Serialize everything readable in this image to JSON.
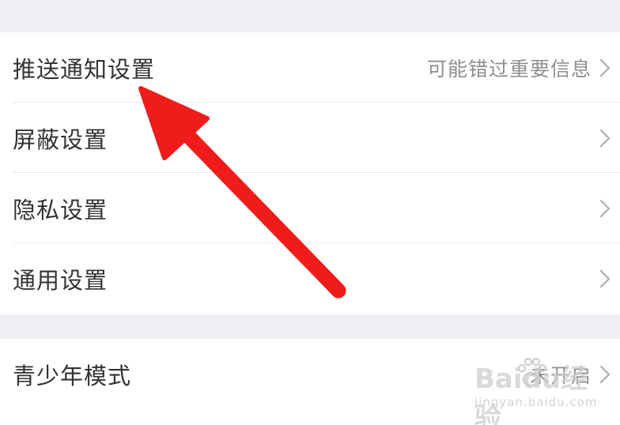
{
  "settings_groups": [
    {
      "rows": [
        {
          "label": "推送通知设置",
          "value": "可能错过重要信息"
        },
        {
          "label": "屏蔽设置",
          "value": ""
        },
        {
          "label": "隐私设置",
          "value": ""
        },
        {
          "label": "通用设置",
          "value": ""
        }
      ]
    },
    {
      "rows": [
        {
          "label": "青少年模式",
          "value": "未开启"
        }
      ]
    }
  ],
  "icons": {
    "chevron": "chevron-right-icon",
    "annotation": "red-arrow-annotation",
    "watermark_logo": "baidu-paw-icon"
  },
  "colors": {
    "background": "#efeff4",
    "row_bg": "#ffffff",
    "label_text": "#333333",
    "value_text": "#8f8f8f",
    "chevron": "#b5b5b5",
    "arrow": "#f01c1c"
  },
  "watermark": {
    "logo_text": "Baidu经验",
    "url_text": "jingyan.baidu.com"
  }
}
